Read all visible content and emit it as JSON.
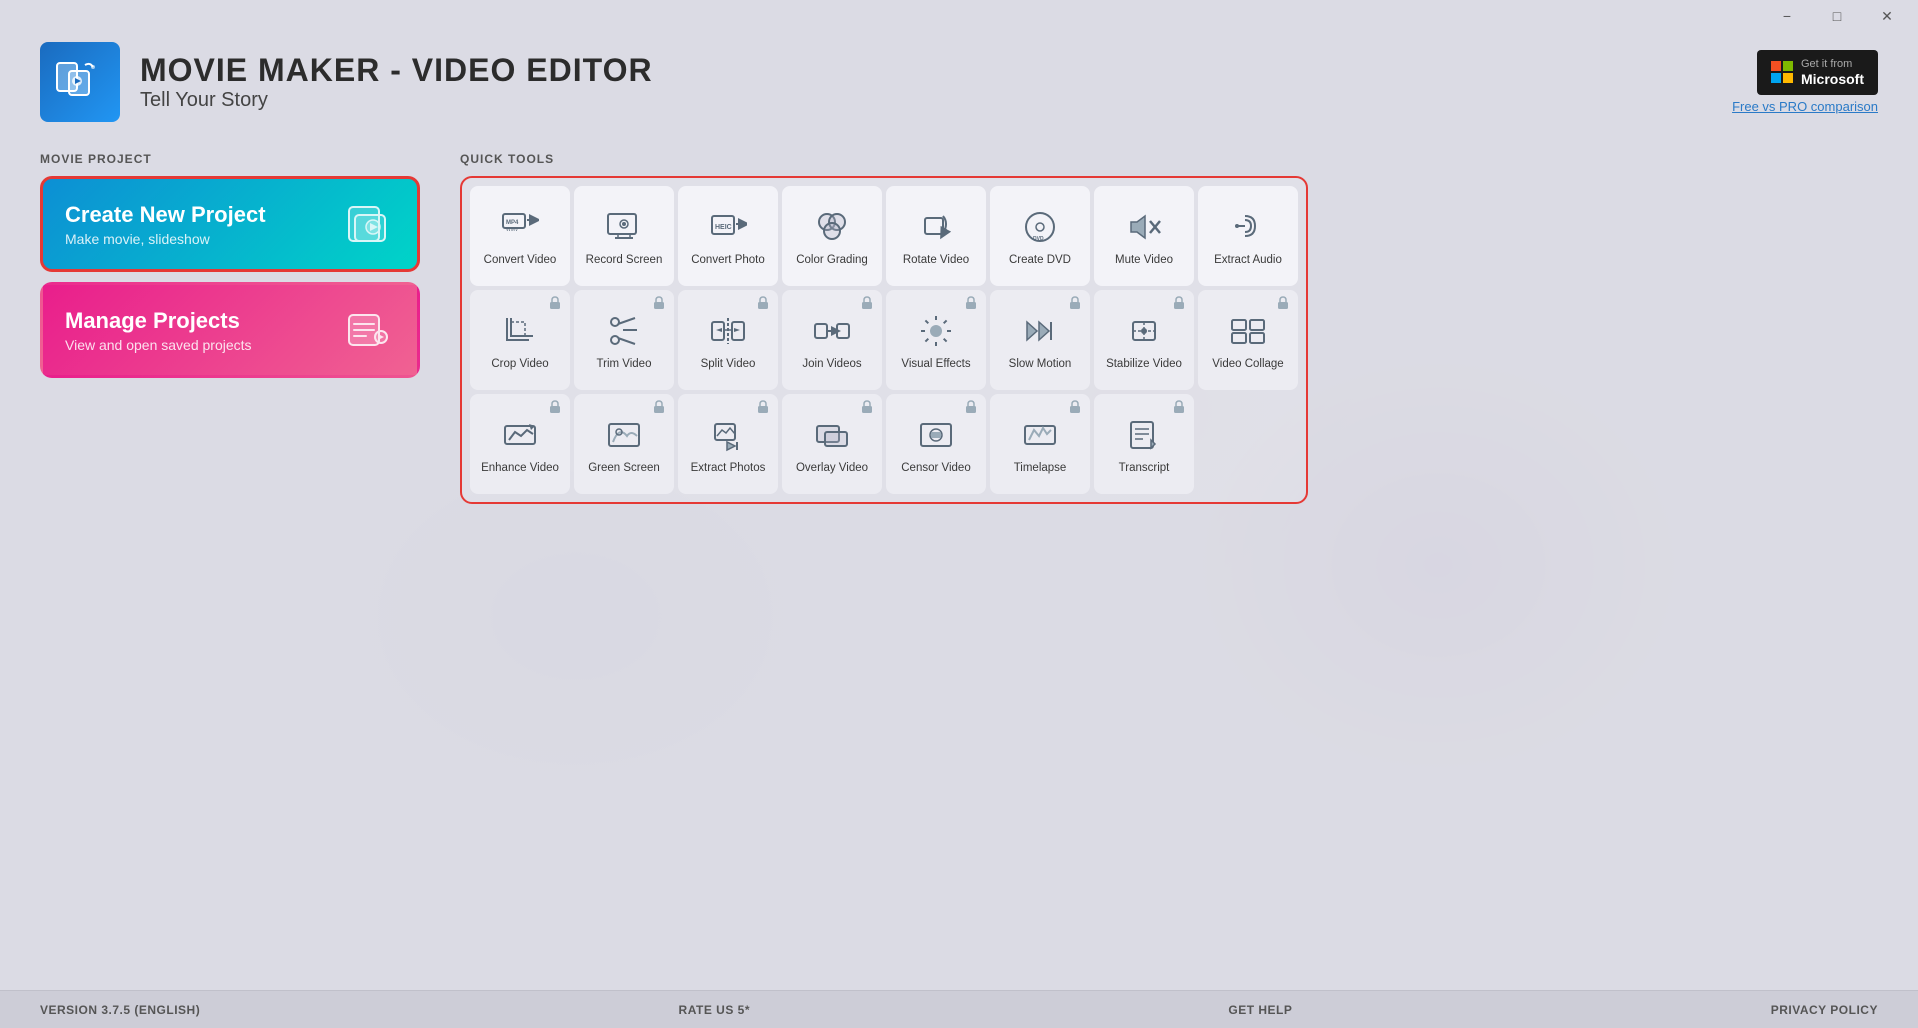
{
  "window": {
    "title": "Movie Maker - Video Editor",
    "titlebar": {
      "minimize": "−",
      "maximize": "□",
      "close": "✕"
    }
  },
  "header": {
    "app_title": "MOVIE MAKER - VIDEO EDITOR",
    "app_subtitle": "Tell Your Story",
    "microsoft_badge": {
      "get_it": "Get it from",
      "name": "Microsoft"
    },
    "free_pro_link": "Free vs PRO comparison"
  },
  "left_panel": {
    "section_label": "MOVIE PROJECT",
    "create_card": {
      "title": "Create New Project",
      "subtitle": "Make movie, slideshow"
    },
    "manage_card": {
      "title": "Manage Projects",
      "subtitle": "View and open saved projects"
    }
  },
  "quick_tools": {
    "section_label": "QUICK TOOLS",
    "row1": [
      {
        "id": "convert-video",
        "label": "Convert Video",
        "icon": "convert-video-icon",
        "locked": false
      },
      {
        "id": "record-screen",
        "label": "Record Screen",
        "icon": "record-screen-icon",
        "locked": false
      },
      {
        "id": "convert-photo",
        "label": "Convert Photo",
        "icon": "convert-photo-icon",
        "locked": false
      },
      {
        "id": "color-grading",
        "label": "Color Grading",
        "icon": "color-grading-icon",
        "locked": false
      },
      {
        "id": "rotate-video",
        "label": "Rotate Video",
        "icon": "rotate-video-icon",
        "locked": false
      },
      {
        "id": "create-dvd",
        "label": "Create DVD",
        "icon": "create-dvd-icon",
        "locked": false
      },
      {
        "id": "mute-video",
        "label": "Mute Video",
        "icon": "mute-video-icon",
        "locked": false
      },
      {
        "id": "extract-audio",
        "label": "Extract Audio",
        "icon": "extract-audio-icon",
        "locked": false
      }
    ],
    "row2": [
      {
        "id": "crop-video",
        "label": "Crop Video",
        "icon": "crop-video-icon",
        "locked": true
      },
      {
        "id": "trim-video",
        "label": "Trim Video",
        "icon": "trim-video-icon",
        "locked": true
      },
      {
        "id": "split-video",
        "label": "Split Video",
        "icon": "split-video-icon",
        "locked": true
      },
      {
        "id": "join-videos",
        "label": "Join Videos",
        "icon": "join-videos-icon",
        "locked": true
      },
      {
        "id": "visual-effects",
        "label": "Visual Effects",
        "icon": "visual-effects-icon",
        "locked": true
      },
      {
        "id": "slow-motion",
        "label": "Slow Motion",
        "icon": "slow-motion-icon",
        "locked": true
      },
      {
        "id": "stabilize-video",
        "label": "Stabilize Video",
        "icon": "stabilize-video-icon",
        "locked": true
      },
      {
        "id": "video-collage",
        "label": "Video Collage",
        "icon": "video-collage-icon",
        "locked": true
      }
    ],
    "row3": [
      {
        "id": "enhance-video",
        "label": "Enhance Video",
        "icon": "enhance-video-icon",
        "locked": true
      },
      {
        "id": "green-screen",
        "label": "Green Screen",
        "icon": "green-screen-icon",
        "locked": true
      },
      {
        "id": "extract-photos",
        "label": "Extract Photos",
        "icon": "extract-photos-icon",
        "locked": true
      },
      {
        "id": "overlay-video",
        "label": "Overlay Video",
        "icon": "overlay-video-icon",
        "locked": true
      },
      {
        "id": "censor-video",
        "label": "Censor Video",
        "icon": "censor-video-icon",
        "locked": true
      },
      {
        "id": "timelapse",
        "label": "Timelapse",
        "icon": "timelapse-icon",
        "locked": true
      },
      {
        "id": "transcript",
        "label": "Transcript",
        "icon": "transcript-icon",
        "locked": true
      }
    ]
  },
  "footer": {
    "version": "VERSION 3.7.5 (English)",
    "rate": "RATE US 5*",
    "help": "GET HELP",
    "privacy": "PRIVACY POLICY"
  }
}
